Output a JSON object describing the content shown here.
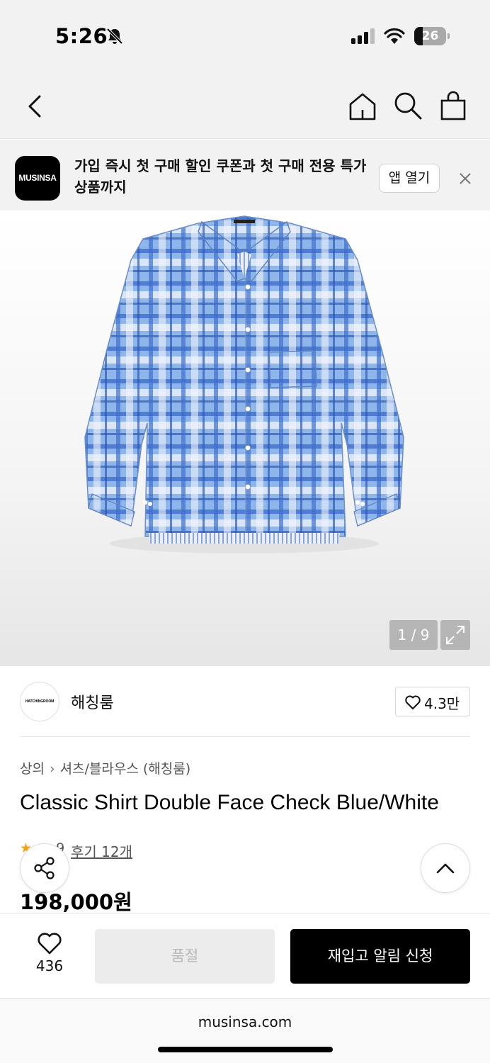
{
  "status_bar": {
    "time": "5:26",
    "battery": "26",
    "battery_level": 0.26,
    "icons": [
      "bell-off-icon",
      "cellular-signal-icon",
      "wifi-icon",
      "battery-icon"
    ]
  },
  "nav": {
    "icons": [
      "back-chevron-icon",
      "home-icon",
      "search-icon",
      "shopping-bag-icon"
    ]
  },
  "app_banner": {
    "logo_text": "MUSINSA",
    "message": "가입 즉시 첫 구매 할인 쿠폰과 첫 구매 전용 특가 상품까지",
    "open_button": "앱 열기",
    "close_icon": "close-icon"
  },
  "gallery": {
    "counter": "1 / 9",
    "current": 1,
    "total": 9,
    "image_subject": "blue-white-check-shirt",
    "expand_icon": "expand-arrows-icon"
  },
  "brand": {
    "logo_text": "HATCHINGROOM",
    "name": "해칭룸",
    "like_count": "4.3만"
  },
  "product": {
    "breadcrumb": [
      "상의",
      "셔츠/블라우스 (해칭룸)"
    ],
    "title": "Classic Shirt Double Face Check Blue/White",
    "rating_partial": "9",
    "review_link": "후기 12개",
    "price": "198,000원"
  },
  "buy_bar": {
    "wish_count": "436",
    "soldout_label": "품절",
    "restock_label": "재입고 알림 신청"
  },
  "browser": {
    "url": "musinsa.com"
  },
  "colors": {
    "background": "#ffffff",
    "header_bg": "#f2f2f2",
    "primary_button": "#000000",
    "disabled_button": "#ececec",
    "star": "#f3a312",
    "shirt_blue": "#5b8fd8"
  }
}
